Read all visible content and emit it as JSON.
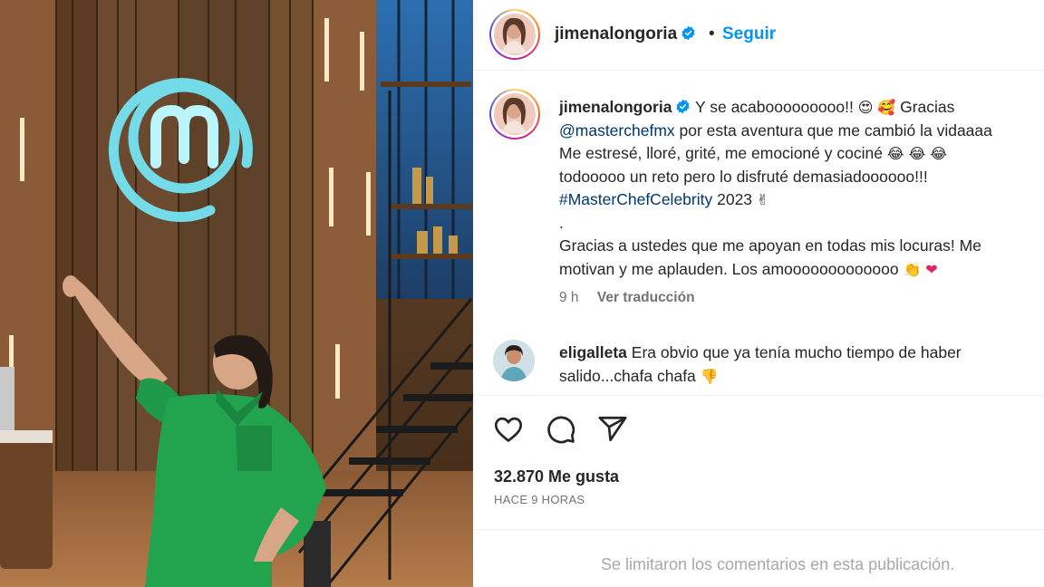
{
  "post": {
    "author": "jimenalongoria",
    "follow_label": "Seguir",
    "dot": "•",
    "caption": {
      "line1_after_name": "Y se acabooooooooo!!",
      "line1_tail": "Gracias",
      "mention": "@masterchefmx",
      "line2_tail": "por esta aventura que me cambió la vidaaaa",
      "line3": "Me estresé, lloré, grité, me emocioné y cociné",
      "line4": "todooooo un reto pero lo disfruté demasiadoooooo!!!",
      "hashtag": "#MasterChefCelebrity",
      "year": "2023",
      "separator": ".",
      "line6": "Gracias a ustedes que me apoyan en todas mis locuras! Me",
      "line7": "motivan y me aplauden. Los amooooooooooooo"
    },
    "caption_time": "9 h",
    "translate_label": "Ver traducción"
  },
  "comment": {
    "author": "eligalleta",
    "line1": "Era obvio que ya tenía mucho tiempo de haber",
    "line2": "salido...chafa chafa"
  },
  "actions": {
    "icons": [
      "heart-icon",
      "comment-icon",
      "share-icon"
    ],
    "likes": "32.870 Me gusta",
    "posted": "HACE 9 HORAS"
  },
  "footer": {
    "limited": "Se limitaron los comentarios en esta publicación."
  },
  "colors": {
    "link": "#0095f6",
    "mention": "#00376b",
    "muted": "#737373",
    "verified": "#0095f6"
  }
}
